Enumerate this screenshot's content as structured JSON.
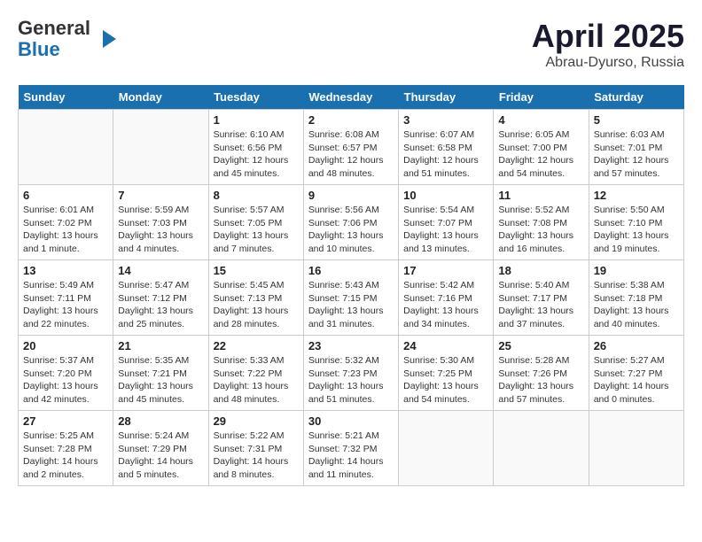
{
  "logo": {
    "general": "General",
    "blue": "Blue"
  },
  "title": "April 2025",
  "subtitle": "Abrau-Dyurso, Russia",
  "weekdays": [
    "Sunday",
    "Monday",
    "Tuesday",
    "Wednesday",
    "Thursday",
    "Friday",
    "Saturday"
  ],
  "weeks": [
    [
      {
        "day": "",
        "info": ""
      },
      {
        "day": "",
        "info": ""
      },
      {
        "day": "1",
        "info": "Sunrise: 6:10 AM\nSunset: 6:56 PM\nDaylight: 12 hours\nand 45 minutes."
      },
      {
        "day": "2",
        "info": "Sunrise: 6:08 AM\nSunset: 6:57 PM\nDaylight: 12 hours\nand 48 minutes."
      },
      {
        "day": "3",
        "info": "Sunrise: 6:07 AM\nSunset: 6:58 PM\nDaylight: 12 hours\nand 51 minutes."
      },
      {
        "day": "4",
        "info": "Sunrise: 6:05 AM\nSunset: 7:00 PM\nDaylight: 12 hours\nand 54 minutes."
      },
      {
        "day": "5",
        "info": "Sunrise: 6:03 AM\nSunset: 7:01 PM\nDaylight: 12 hours\nand 57 minutes."
      }
    ],
    [
      {
        "day": "6",
        "info": "Sunrise: 6:01 AM\nSunset: 7:02 PM\nDaylight: 13 hours\nand 1 minute."
      },
      {
        "day": "7",
        "info": "Sunrise: 5:59 AM\nSunset: 7:03 PM\nDaylight: 13 hours\nand 4 minutes."
      },
      {
        "day": "8",
        "info": "Sunrise: 5:57 AM\nSunset: 7:05 PM\nDaylight: 13 hours\nand 7 minutes."
      },
      {
        "day": "9",
        "info": "Sunrise: 5:56 AM\nSunset: 7:06 PM\nDaylight: 13 hours\nand 10 minutes."
      },
      {
        "day": "10",
        "info": "Sunrise: 5:54 AM\nSunset: 7:07 PM\nDaylight: 13 hours\nand 13 minutes."
      },
      {
        "day": "11",
        "info": "Sunrise: 5:52 AM\nSunset: 7:08 PM\nDaylight: 13 hours\nand 16 minutes."
      },
      {
        "day": "12",
        "info": "Sunrise: 5:50 AM\nSunset: 7:10 PM\nDaylight: 13 hours\nand 19 minutes."
      }
    ],
    [
      {
        "day": "13",
        "info": "Sunrise: 5:49 AM\nSunset: 7:11 PM\nDaylight: 13 hours\nand 22 minutes."
      },
      {
        "day": "14",
        "info": "Sunrise: 5:47 AM\nSunset: 7:12 PM\nDaylight: 13 hours\nand 25 minutes."
      },
      {
        "day": "15",
        "info": "Sunrise: 5:45 AM\nSunset: 7:13 PM\nDaylight: 13 hours\nand 28 minutes."
      },
      {
        "day": "16",
        "info": "Sunrise: 5:43 AM\nSunset: 7:15 PM\nDaylight: 13 hours\nand 31 minutes."
      },
      {
        "day": "17",
        "info": "Sunrise: 5:42 AM\nSunset: 7:16 PM\nDaylight: 13 hours\nand 34 minutes."
      },
      {
        "day": "18",
        "info": "Sunrise: 5:40 AM\nSunset: 7:17 PM\nDaylight: 13 hours\nand 37 minutes."
      },
      {
        "day": "19",
        "info": "Sunrise: 5:38 AM\nSunset: 7:18 PM\nDaylight: 13 hours\nand 40 minutes."
      }
    ],
    [
      {
        "day": "20",
        "info": "Sunrise: 5:37 AM\nSunset: 7:20 PM\nDaylight: 13 hours\nand 42 minutes."
      },
      {
        "day": "21",
        "info": "Sunrise: 5:35 AM\nSunset: 7:21 PM\nDaylight: 13 hours\nand 45 minutes."
      },
      {
        "day": "22",
        "info": "Sunrise: 5:33 AM\nSunset: 7:22 PM\nDaylight: 13 hours\nand 48 minutes."
      },
      {
        "day": "23",
        "info": "Sunrise: 5:32 AM\nSunset: 7:23 PM\nDaylight: 13 hours\nand 51 minutes."
      },
      {
        "day": "24",
        "info": "Sunrise: 5:30 AM\nSunset: 7:25 PM\nDaylight: 13 hours\nand 54 minutes."
      },
      {
        "day": "25",
        "info": "Sunrise: 5:28 AM\nSunset: 7:26 PM\nDaylight: 13 hours\nand 57 minutes."
      },
      {
        "day": "26",
        "info": "Sunrise: 5:27 AM\nSunset: 7:27 PM\nDaylight: 14 hours\nand 0 minutes."
      }
    ],
    [
      {
        "day": "27",
        "info": "Sunrise: 5:25 AM\nSunset: 7:28 PM\nDaylight: 14 hours\nand 2 minutes."
      },
      {
        "day": "28",
        "info": "Sunrise: 5:24 AM\nSunset: 7:29 PM\nDaylight: 14 hours\nand 5 minutes."
      },
      {
        "day": "29",
        "info": "Sunrise: 5:22 AM\nSunset: 7:31 PM\nDaylight: 14 hours\nand 8 minutes."
      },
      {
        "day": "30",
        "info": "Sunrise: 5:21 AM\nSunset: 7:32 PM\nDaylight: 14 hours\nand 11 minutes."
      },
      {
        "day": "",
        "info": ""
      },
      {
        "day": "",
        "info": ""
      },
      {
        "day": "",
        "info": ""
      }
    ]
  ]
}
